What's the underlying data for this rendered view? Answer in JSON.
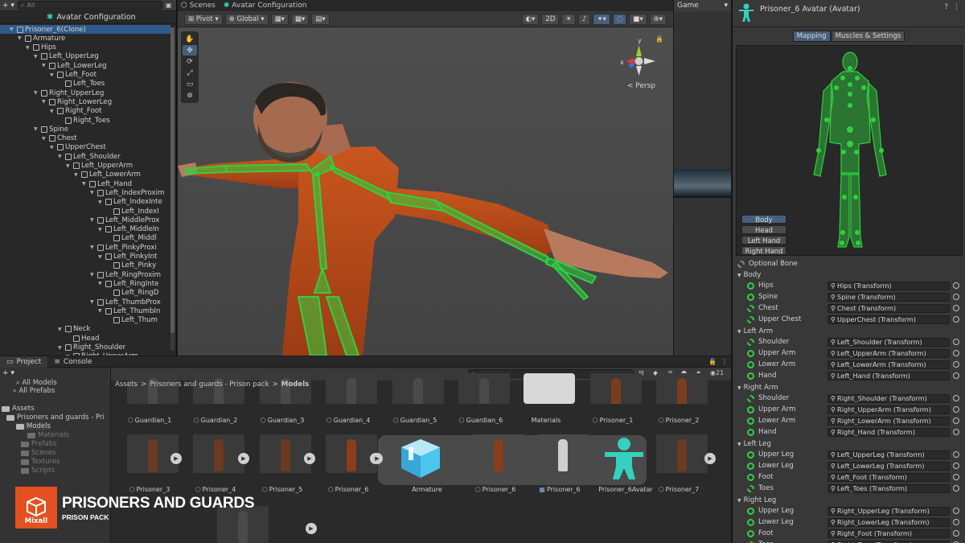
{
  "hierarchy": {
    "search_placeholder": "All",
    "header_title": "Avatar Configuration",
    "items": [
      {
        "label": "Prisoner_6(Clone)",
        "depth": 2
      },
      {
        "label": "Armature",
        "depth": 3
      },
      {
        "label": "Hips",
        "depth": 4
      },
      {
        "label": "Left_UpperLeg",
        "depth": 5
      },
      {
        "label": "Left_LowerLeg",
        "depth": 6
      },
      {
        "label": "Left_Foot",
        "depth": 7
      },
      {
        "label": "Left_Toes",
        "depth": 8
      },
      {
        "label": "Right_UpperLeg",
        "depth": 5
      },
      {
        "label": "Right_LowerLeg",
        "depth": 6
      },
      {
        "label": "Right_Foot",
        "depth": 7
      },
      {
        "label": "Right_Toes",
        "depth": 8
      },
      {
        "label": "Spine",
        "depth": 5
      },
      {
        "label": "Chest",
        "depth": 6
      },
      {
        "label": "UpperChest",
        "depth": 7
      },
      {
        "label": "Left_Shoulder",
        "depth": 8
      },
      {
        "label": "Left_UpperArm",
        "depth": 9
      },
      {
        "label": "Left_LowerArm",
        "depth": 10
      },
      {
        "label": "Left_Hand",
        "depth": 11
      },
      {
        "label": "Left_IndexProxim",
        "depth": 12
      },
      {
        "label": "Left_IndexInte",
        "depth": 13
      },
      {
        "label": "Left_IndexI",
        "depth": 14
      },
      {
        "label": "Left_MiddleProx",
        "depth": 12
      },
      {
        "label": "Left_MiddleIn",
        "depth": 13
      },
      {
        "label": "Left_Middl",
        "depth": 14
      },
      {
        "label": "Left_PinkyProxi",
        "depth": 12
      },
      {
        "label": "Left_PinkyInt",
        "depth": 13
      },
      {
        "label": "Left_Pinky",
        "depth": 14
      },
      {
        "label": "Left_RingProxim",
        "depth": 12
      },
      {
        "label": "Left_RingInte",
        "depth": 13
      },
      {
        "label": "Left_RingD",
        "depth": 14
      },
      {
        "label": "Left_ThumbProx",
        "depth": 12
      },
      {
        "label": "Left_ThumbIn",
        "depth": 13
      },
      {
        "label": "Left_Thum",
        "depth": 14
      },
      {
        "label": "Neck",
        "depth": 8
      },
      {
        "label": "Head",
        "depth": 9
      },
      {
        "label": "Right_Shoulder",
        "depth": 8
      },
      {
        "label": "Right_UpperArm",
        "depth": 9
      }
    ]
  },
  "scene": {
    "tabs": {
      "scenes": "Scenes",
      "avatar": "Avatar Configuration"
    },
    "pivot": "Pivot",
    "global": "Global",
    "mode_2d": "2D",
    "persp": "Persp",
    "gizmo_y": "y",
    "gizmo_x": "x"
  },
  "game": {
    "tab": "Game"
  },
  "inspector": {
    "title": "Prisoner_6 Avatar (Avatar)",
    "tab_mapping": "Mapping",
    "tab_muscles": "Muscles & Settings",
    "body_parts": [
      "Body",
      "Head",
      "Left Hand",
      "Right Hand"
    ],
    "optional_bone": "Optional Bone",
    "groups": [
      {
        "name": "Body",
        "bones": [
          {
            "name": "Hips",
            "value": "Hips (Transform)",
            "optional": false
          },
          {
            "name": "Spine",
            "value": "Spine (Transform)",
            "optional": false
          },
          {
            "name": "Chest",
            "value": "Chest (Transform)",
            "optional": true
          },
          {
            "name": "Upper Chest",
            "value": "UpperChest (Transform)",
            "optional": true
          }
        ]
      },
      {
        "name": "Left Arm",
        "bones": [
          {
            "name": "Shoulder",
            "value": "Left_Shoulder (Transform)",
            "optional": true
          },
          {
            "name": "Upper Arm",
            "value": "Left_UpperArm (Transform)",
            "optional": false
          },
          {
            "name": "Lower Arm",
            "value": "Left_LowerArm (Transform)",
            "optional": false
          },
          {
            "name": "Hand",
            "value": "Left_Hand (Transform)",
            "optional": false
          }
        ]
      },
      {
        "name": "Right Arm",
        "bones": [
          {
            "name": "Shoulder",
            "value": "Right_Shoulder (Transform)",
            "optional": true
          },
          {
            "name": "Upper Arm",
            "value": "Right_UpperArm (Transform)",
            "optional": false
          },
          {
            "name": "Lower Arm",
            "value": "Right_LowerArm (Transform)",
            "optional": false
          },
          {
            "name": "Hand",
            "value": "Right_Hand (Transform)",
            "optional": false
          }
        ]
      },
      {
        "name": "Left Leg",
        "bones": [
          {
            "name": "Upper Leg",
            "value": "Left_UpperLeg (Transform)",
            "optional": false
          },
          {
            "name": "Lower Leg",
            "value": "Left_LowerLeg (Transform)",
            "optional": false
          },
          {
            "name": "Foot",
            "value": "Left_Foot (Transform)",
            "optional": false
          },
          {
            "name": "Toes",
            "value": "Left_Toes (Transform)",
            "optional": true
          }
        ]
      },
      {
        "name": "Right Leg",
        "bones": [
          {
            "name": "Upper Leg",
            "value": "Right_UpperLeg (Transform)",
            "optional": false
          },
          {
            "name": "Lower Leg",
            "value": "Right_LowerLeg (Transform)",
            "optional": false
          },
          {
            "name": "Foot",
            "value": "Right_Foot (Transform)",
            "optional": false
          },
          {
            "name": "Toes",
            "value": "Right_Toes (Transform)",
            "optional": true
          }
        ]
      }
    ]
  },
  "project": {
    "tab_project": "Project",
    "tab_console": "Console",
    "badge_count": "21",
    "left_items": [
      "All Models",
      "All Prefabs",
      "Assets",
      "Prisoners and guards - Pri",
      "Models",
      "Materials",
      "Prefabs",
      "Scenes",
      "Textures",
      "Scripts"
    ],
    "breadcrumb": [
      "Assets",
      "Prisoners and guards - Prison pack",
      "Models"
    ],
    "row1": [
      "Guardian_1",
      "Guardian_2",
      "Guardian_3",
      "Guardian_4",
      "Guardian_5",
      "Guardian_6",
      "Materials",
      "Prisoner_1",
      "Prisoner_2"
    ],
    "row2": [
      "Prisoner_3",
      "Prisoner_4",
      "Prisoner_5",
      "Prisoner_6",
      "Armature",
      "Prisoner_6",
      "Prisoner_6",
      "Prisoner_6Avatar",
      "Prisoner_7"
    ]
  },
  "brand": {
    "logo_text": "Mixall",
    "title": "PRISONERS AND GUARDS",
    "subtitle": "PRISON PACK"
  },
  "colors": {
    "selection": "#2f5a89",
    "bone_green": "#2fd13f",
    "suit_orange": "#c0501c",
    "brand_orange": "#e4501f"
  }
}
